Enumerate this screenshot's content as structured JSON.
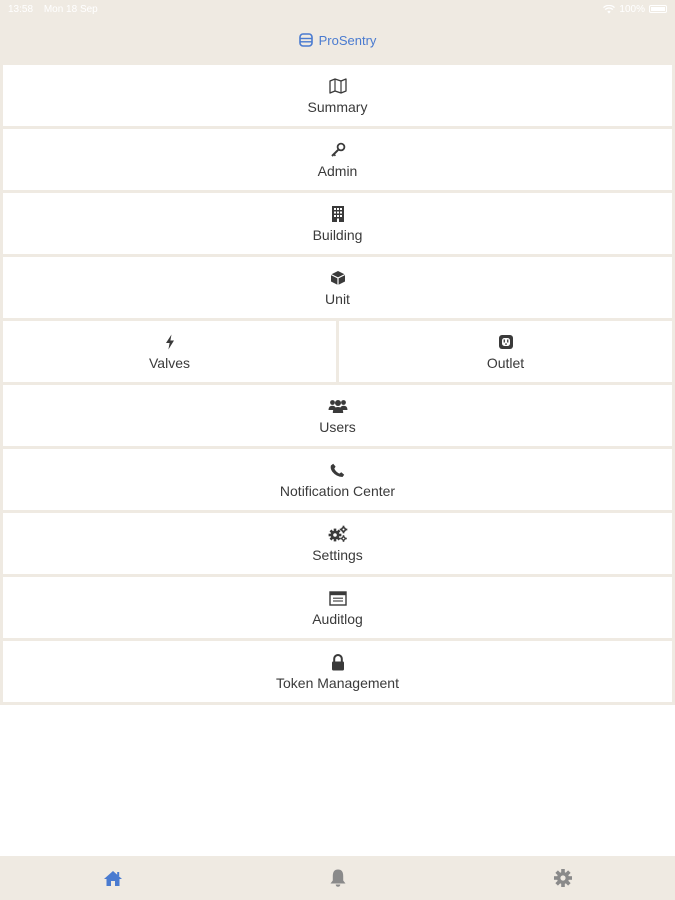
{
  "status_bar": {
    "time": "13:58",
    "date": "Mon 18 Sep",
    "battery": "100%"
  },
  "header": {
    "title": "ProSentry"
  },
  "menu": {
    "summary": "Summary",
    "admin": "Admin",
    "building": "Building",
    "unit": "Unit",
    "valves": "Valves",
    "outlet": "Outlet",
    "users": "Users",
    "notification_center": "Notification Center",
    "settings": "Settings",
    "auditlog": "Auditlog",
    "token_management": "Token Management"
  },
  "tabbar": {
    "items": [
      {
        "icon": "home-icon",
        "active": true
      },
      {
        "icon": "bell-icon",
        "active": false
      },
      {
        "icon": "gear-icon",
        "active": false
      }
    ]
  },
  "colors": {
    "accent": "#4a7bd0",
    "chrome": "#efeae2",
    "icon": "#3a3a3a",
    "inactive_tab": "#8a8a8a"
  }
}
